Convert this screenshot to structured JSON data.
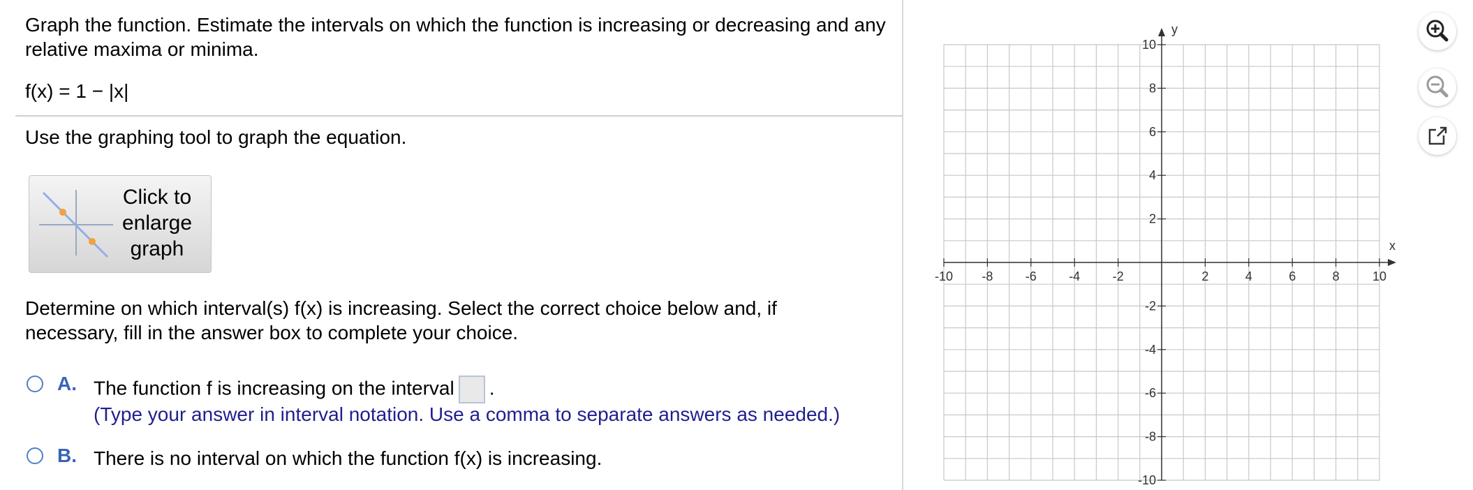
{
  "question": {
    "prompt": "Graph the function. Estimate the intervals on which the function is increasing or decreasing and any relative maxima or minima.",
    "function": "f(x) = 1 − |x|",
    "instruction": "Use the graphing tool to graph the equation.",
    "enlarge_label": "Click to\nenlarge\ngraph",
    "determine": "Determine on which interval(s) f(x) is increasing. Select the correct choice below and, if necessary, fill in the answer box to complete your choice."
  },
  "choices": [
    {
      "letter": "A.",
      "text_before": "The function f is increasing on the interval",
      "text_after": ".",
      "hint": "(Type your answer in interval notation. Use a comma to separate answers as needed.)",
      "answer": ""
    },
    {
      "letter": "B.",
      "text": "There is no interval on which the function f(x) is increasing."
    }
  ],
  "graph": {
    "x_label": "x",
    "y_label": "y",
    "x_ticks": [
      -10,
      -8,
      -6,
      -4,
      -2,
      2,
      4,
      6,
      8,
      10
    ],
    "y_ticks": [
      10,
      8,
      6,
      4,
      2,
      -2,
      -4,
      -6,
      -8,
      -10
    ],
    "range": [
      -10,
      10
    ],
    "grid_step": 1
  },
  "tools": [
    "zoom-in-icon",
    "zoom-out-icon",
    "popout-icon"
  ],
  "colors": {
    "accent": "#3a63b8",
    "hint": "#1f1f8f",
    "radio": "#4d80c9"
  }
}
